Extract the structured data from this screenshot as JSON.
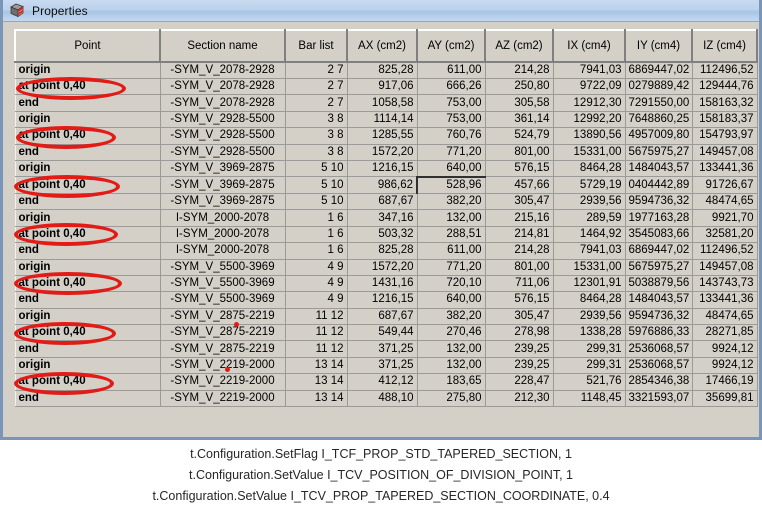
{
  "window": {
    "title": "Properties",
    "icon": "cube-icon",
    "title_bar_color": "#bcd3ec",
    "frame_color": "#7996b8",
    "surface_color": "#d4d0c8"
  },
  "table": {
    "columns": [
      "Point",
      "Section name",
      "Bar list",
      "AX (cm2)",
      "AY (cm2)",
      "AZ (cm2)",
      "IX (cm4)",
      "IY (cm4)",
      "IZ (cm4)"
    ],
    "selected_cell": {
      "row": 7,
      "column": 4,
      "value": "528,96"
    },
    "rows": [
      {
        "point": "origin",
        "section": "-SYM_V_2078-2928",
        "bar": "2 7",
        "ax": "825,28",
        "ay": "611,00",
        "az": "214,28",
        "ix": "7941,03",
        "iy": "6869447,02",
        "iz": "112496,52"
      },
      {
        "point": "at point 0,40",
        "section": "-SYM_V_2078-2928",
        "bar": "2 7",
        "ax": "917,06",
        "ay": "666,26",
        "az": "250,80",
        "ix": "9722,09",
        "iy": "0279889,42",
        "iz": "129444,76"
      },
      {
        "point": "end",
        "section": "-SYM_V_2078-2928",
        "bar": "2 7",
        "ax": "1058,58",
        "ay": "753,00",
        "az": "305,58",
        "ix": "12912,30",
        "iy": "7291550,00",
        "iz": "158163,32"
      },
      {
        "point": "origin",
        "section": "-SYM_V_2928-5500",
        "bar": "3 8",
        "ax": "1114,14",
        "ay": "753,00",
        "az": "361,14",
        "ix": "12992,20",
        "iy": "7648860,25",
        "iz": "158183,37"
      },
      {
        "point": "at point 0,40",
        "section": "-SYM_V_2928-5500",
        "bar": "3 8",
        "ax": "1285,55",
        "ay": "760,76",
        "az": "524,79",
        "ix": "13890,56",
        "iy": "4957009,80",
        "iz": "154793,97"
      },
      {
        "point": "end",
        "section": "-SYM_V_2928-5500",
        "bar": "3 8",
        "ax": "1572,20",
        "ay": "771,20",
        "az": "801,00",
        "ix": "15331,00",
        "iy": "5675975,27",
        "iz": "149457,08"
      },
      {
        "point": "origin",
        "section": "-SYM_V_3969-2875",
        "bar": "5 10",
        "ax": "1216,15",
        "ay": "640,00",
        "az": "576,15",
        "ix": "8464,28",
        "iy": "1484043,57",
        "iz": "133441,36"
      },
      {
        "point": "at point 0,40",
        "section": "-SYM_V_3969-2875",
        "bar": "5 10",
        "ax": "986,62",
        "ay": "528,96",
        "az": "457,66",
        "ix": "5729,19",
        "iy": "0404442,89",
        "iz": "91726,67"
      },
      {
        "point": "end",
        "section": "-SYM_V_3969-2875",
        "bar": "5 10",
        "ax": "687,67",
        "ay": "382,20",
        "az": "305,47",
        "ix": "2939,56",
        "iy": "9594736,32",
        "iz": "48474,65"
      },
      {
        "point": "origin",
        "section": "I-SYM_2000-2078",
        "bar": "1 6",
        "ax": "347,16",
        "ay": "132,00",
        "az": "215,16",
        "ix": "289,59",
        "iy": "1977163,28",
        "iz": "9921,70"
      },
      {
        "point": "at point 0,40",
        "section": "I-SYM_2000-2078",
        "bar": "1 6",
        "ax": "503,32",
        "ay": "288,51",
        "az": "214,81",
        "ix": "1464,92",
        "iy": "3545083,66",
        "iz": "32581,20"
      },
      {
        "point": "end",
        "section": "I-SYM_2000-2078",
        "bar": "1 6",
        "ax": "825,28",
        "ay": "611,00",
        "az": "214,28",
        "ix": "7941,03",
        "iy": "6869447,02",
        "iz": "112496,52"
      },
      {
        "point": "origin",
        "section": "-SYM_V_5500-3969",
        "bar": "4 9",
        "ax": "1572,20",
        "ay": "771,20",
        "az": "801,00",
        "ix": "15331,00",
        "iy": "5675975,27",
        "iz": "149457,08"
      },
      {
        "point": "at point 0,40",
        "section": "-SYM_V_5500-3969",
        "bar": "4 9",
        "ax": "1431,16",
        "ay": "720,10",
        "az": "711,06",
        "ix": "12301,91",
        "iy": "5038879,56",
        "iz": "143743,73"
      },
      {
        "point": "end",
        "section": "-SYM_V_5500-3969",
        "bar": "4 9",
        "ax": "1216,15",
        "ay": "640,00",
        "az": "576,15",
        "ix": "8464,28",
        "iy": "1484043,57",
        "iz": "133441,36"
      },
      {
        "point": "origin",
        "section": "-SYM_V_2875-2219",
        "bar": "11 12",
        "ax": "687,67",
        "ay": "382,20",
        "az": "305,47",
        "ix": "2939,56",
        "iy": "9594736,32",
        "iz": "48474,65"
      },
      {
        "point": "at point 0,40",
        "section": "-SYM_V_2875-2219",
        "bar": "11 12",
        "ax": "549,44",
        "ay": "270,46",
        "az": "278,98",
        "ix": "1338,28",
        "iy": "5976886,33",
        "iz": "28271,85"
      },
      {
        "point": "end",
        "section": "-SYM_V_2875-2219",
        "bar": "11 12",
        "ax": "371,25",
        "ay": "132,00",
        "az": "239,25",
        "ix": "299,31",
        "iy": "2536068,57",
        "iz": "9924,12"
      },
      {
        "point": "origin",
        "section": "-SYM_V_2219-2000",
        "bar": "13 14",
        "ax": "371,25",
        "ay": "132,00",
        "az": "239,25",
        "ix": "299,31",
        "iy": "2536068,57",
        "iz": "9924,12"
      },
      {
        "point": "at point 0,40",
        "section": "-SYM_V_2219-2000",
        "bar": "13 14",
        "ax": "412,12",
        "ay": "183,65",
        "az": "228,47",
        "ix": "521,76",
        "iy": "2854346,38",
        "iz": "17466,19"
      },
      {
        "point": "end",
        "section": "-SYM_V_2219-2000",
        "bar": "13 14",
        "ax": "488,10",
        "ay": "275,80",
        "az": "212,30",
        "ix": "1148,45",
        "iy": "3321593,07",
        "iz": "35699,81"
      }
    ]
  },
  "annotations": {
    "color": "#e21b17",
    "description": "red ellipses highlighting the 'at point 0,40' rows"
  },
  "caption": {
    "lines": [
      "t.Configuration.SetFlag I_TCF_PROP_STD_TAPERED_SECTION, 1",
      "t.Configuration.SetValue I_TCV_POSITION_OF_DIVISION_POINT, 1",
      "t.Configuration.SetValue I_TCV_PROP_TAPERED_SECTION_COORDINATE, 0.4"
    ]
  }
}
